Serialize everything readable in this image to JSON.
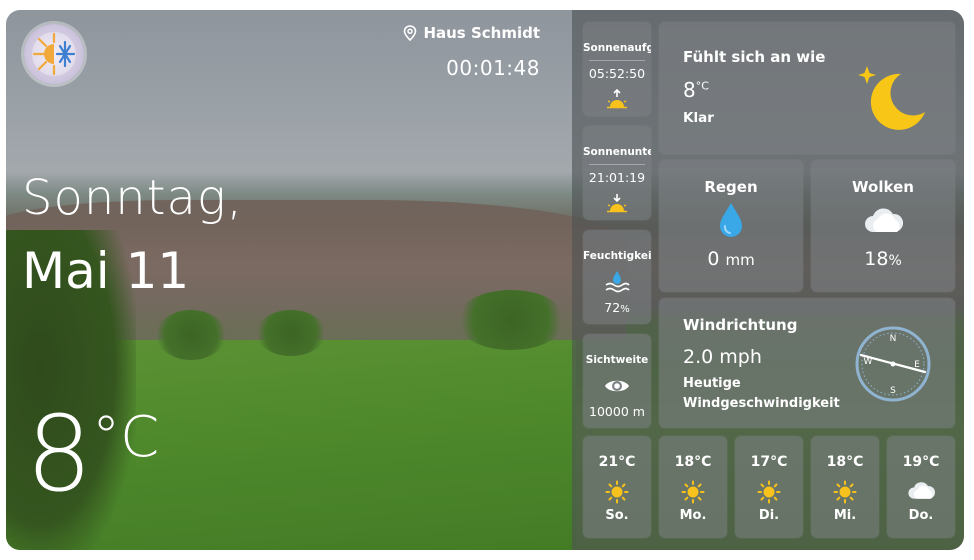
{
  "header": {
    "location": "Haus Schmidt",
    "time": "00:01:48"
  },
  "main": {
    "day": "Sonntag,",
    "date": "Mai 11",
    "temp": "8",
    "temp_unit": "°C"
  },
  "side": [
    {
      "key": "sunrise",
      "title": "Sonnenaufg",
      "value": "05:52:50",
      "icon": "sunrise-icon"
    },
    {
      "key": "sunset",
      "title": "Sonnenunte",
      "value": "21:01:19",
      "icon": "sunset-icon"
    },
    {
      "key": "humidity",
      "title": "Feuchtigkei",
      "value": "72",
      "unit": "%",
      "icon": "humidity-icon"
    },
    {
      "key": "visibility",
      "title": "Sichtweite",
      "value": "10000 m",
      "icon": "eye-icon"
    }
  ],
  "feels": {
    "title": "Fühlt sich an wie",
    "temp": "8",
    "unit": "°C",
    "condition": "Klar",
    "icon": "moon-star-icon"
  },
  "rain": {
    "title": "Regen",
    "value": "0",
    "unit": "mm",
    "icon": "raindrop-icon"
  },
  "clouds": {
    "title": "Wolken",
    "value": "18",
    "unit": "%",
    "icon": "cloud-icon"
  },
  "wind": {
    "title": "Windrichtung",
    "speed": "2.0 mph",
    "label_line1": "Heutige",
    "label_line2": "Windgeschwindigkeit",
    "compass": {
      "n": "N",
      "e": "E",
      "s": "S",
      "w": "W"
    }
  },
  "forecast": [
    {
      "temp": "21°C",
      "day": "So.",
      "icon": "sun-icon"
    },
    {
      "temp": "18°C",
      "day": "Mo.",
      "icon": "sun-icon"
    },
    {
      "temp": "17°C",
      "day": "Di.",
      "icon": "sun-icon"
    },
    {
      "temp": "18°C",
      "day": "Mi.",
      "icon": "sun-icon"
    },
    {
      "temp": "19°C",
      "day": "Do.",
      "icon": "cloud-icon"
    }
  ],
  "colors": {
    "sun": "#f7c21c",
    "moon": "#f7c617",
    "drop": "#3aa7e6",
    "compass": "#8fb3d0"
  }
}
